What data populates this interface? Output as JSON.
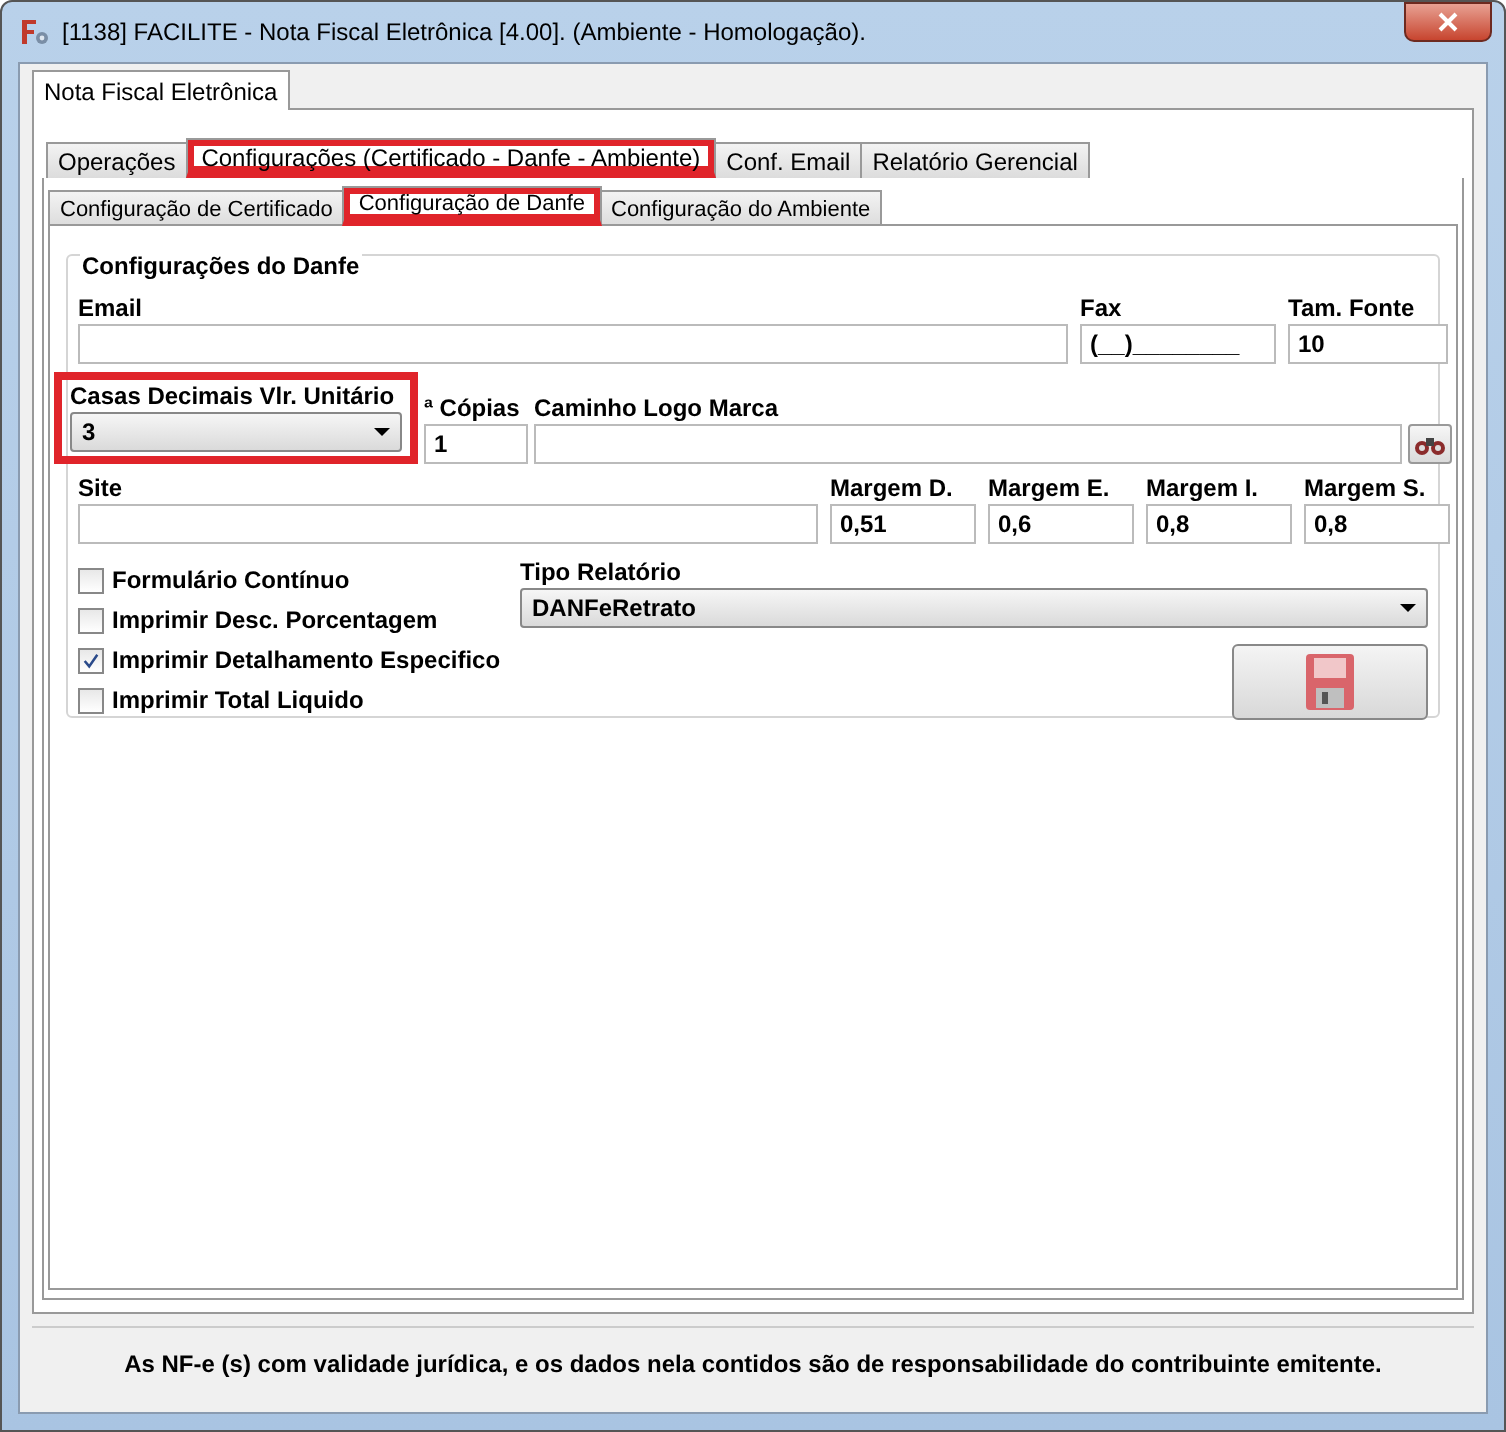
{
  "window": {
    "title": "[1138] FACILITE - Nota Fiscal Eletrônica [4.00]. (Ambiente - Homologação)."
  },
  "main_tabs": [
    {
      "label": "Nota Fiscal Eletrônica",
      "selected": true
    }
  ],
  "tabs": [
    {
      "label": "Operações",
      "selected": false,
      "highlighted": false
    },
    {
      "label": "Configurações (Certificado - Danfe - Ambiente)",
      "selected": true,
      "highlighted": true
    },
    {
      "label": "Conf. Email",
      "selected": false,
      "highlighted": false
    },
    {
      "label": "Relatório Gerencial",
      "selected": false,
      "highlighted": false
    }
  ],
  "sub_tabs": [
    {
      "label": "Configuração de Certificado",
      "selected": false,
      "highlighted": false
    },
    {
      "label": "Configuração de Danfe",
      "selected": true,
      "highlighted": true
    },
    {
      "label": "Configuração do Ambiente",
      "selected": false,
      "highlighted": false
    }
  ],
  "group": {
    "title": "Configurações do Danfe",
    "email": {
      "label": "Email"
    },
    "fax": {
      "label": "Fax",
      "value": "(__)________"
    },
    "font_size": {
      "label": "Tam. Fonte",
      "value": "10"
    },
    "decimals": {
      "label": "Casas Decimais Vlr. Unitário",
      "value": "3",
      "highlighted": true
    },
    "copies": {
      "label": "ª Cópias",
      "value": "1"
    },
    "logo_path": {
      "label": "Caminho Logo Marca"
    },
    "site": {
      "label": "Site"
    },
    "margins": [
      {
        "label": "Margem D.",
        "value": "0,51"
      },
      {
        "label": "Margem E.",
        "value": "0,6"
      },
      {
        "label": "Margem I.",
        "value": "0,8"
      },
      {
        "label": "Margem S.",
        "value": "0,8"
      }
    ],
    "options": [
      {
        "label": "Formulário Contínuo",
        "checked": false
      },
      {
        "label": "Imprimir Desc. Porcentagem",
        "checked": false
      },
      {
        "label": "Imprimir Detalhamento Especifico",
        "checked": true
      },
      {
        "label": "Imprimir Total Liquido",
        "checked": false
      }
    ],
    "report_type": {
      "label": "Tipo Relatório",
      "value": "DANFeRetrato"
    }
  },
  "status_bar": {
    "text": "As NF-e (s) com validade jurídica, e os dados nela contidos são de responsabilidade do contribuinte emitente."
  }
}
